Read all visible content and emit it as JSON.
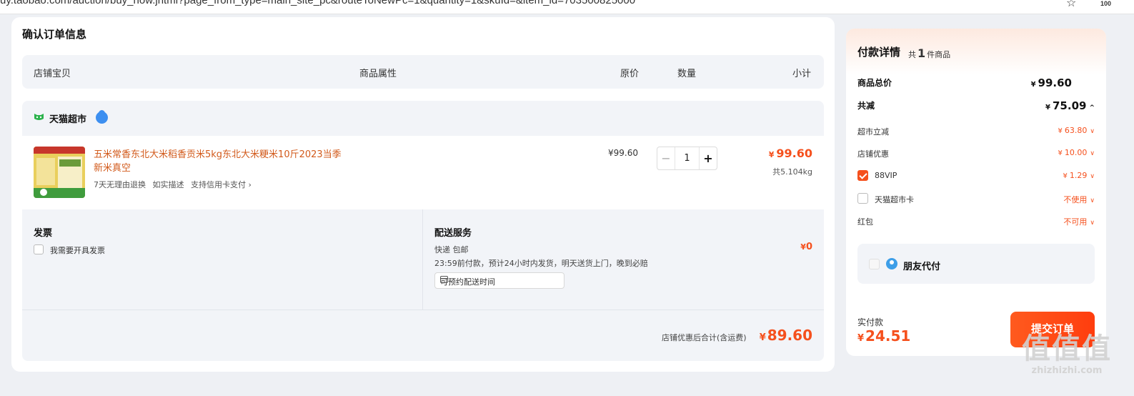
{
  "browser": {
    "url": "uy.taobao.com/auction/buy_now.jhtml?page_from_type=main_site_pc&routeToNewPc=1&quantity=1&skuId=&item_id=703500825000",
    "zoom": "100"
  },
  "order": {
    "title": "确认订单信息",
    "columns": {
      "store_item": "店铺宝贝",
      "attributes": "商品属性",
      "price": "原价",
      "quantity": "数量",
      "subtotal": "小计"
    },
    "shop": {
      "name": "天猫超市"
    },
    "item": {
      "title": "五米常香东北大米稻香贡米5kg东北大米粳米10斤2023当季新米真空",
      "tags": [
        "7天无理由退换",
        "如实描述",
        "支持信用卡支付 ›"
      ],
      "price": "¥99.60",
      "quantity": "1",
      "minus": "−",
      "plus": "+",
      "subtotal_currency": "¥",
      "subtotal": "99.60",
      "weight": "共5.104kg"
    },
    "invoice": {
      "label": "发票",
      "option": "我需要开具发票"
    },
    "delivery": {
      "label": "配送服务",
      "method": "快递 包邮",
      "description": "23:59前付款，预计24小时内发货，明天送货上门，晚到必赔",
      "time_placeholder": "可预约配送时间",
      "fee_currency": "¥",
      "fee": "0"
    },
    "total": {
      "label": "店铺优惠后合计(含运费)",
      "currency": "¥",
      "value": "89.60"
    }
  },
  "payment": {
    "title": "付款详情",
    "count_prefix": "共",
    "count": "1",
    "count_suffix": "件商品",
    "goods_total_label": "商品总价",
    "goods_total_currency": "¥",
    "goods_total": "99.60",
    "discount_label": "共减",
    "discount_currency": "¥",
    "discount": "75.09",
    "discount_chevron": "^",
    "items": [
      {
        "label": "超市立减",
        "currency": "¥",
        "value": "63.80",
        "chevron": "∨"
      },
      {
        "label": "店铺优惠",
        "currency": "¥",
        "value": "10.00",
        "chevron": "∨"
      },
      {
        "label": "88VIP",
        "currency": "¥",
        "value": "1.29",
        "chevron": "∨",
        "checked": true
      },
      {
        "label": "天猫超市卡",
        "value": "不使用",
        "chevron": "∨",
        "checked": false
      },
      {
        "label": "红包",
        "value": "不可用",
        "chevron": "∨"
      }
    ],
    "friend_pay": "朋友代付",
    "actual_label": "实付款",
    "actual_currency": "¥",
    "actual_value": "24.51",
    "submit": "提交订单"
  },
  "watermark": {
    "logo": "值值值",
    "site": "zhizhizhi.com"
  },
  "colors": {
    "accent": "#f5501d",
    "background": "#eef0f4",
    "panel": "#f2f4f8"
  }
}
